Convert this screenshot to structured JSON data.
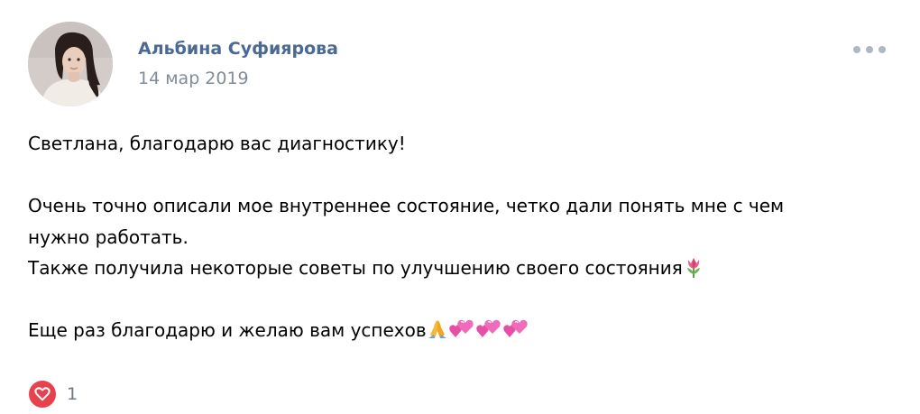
{
  "post": {
    "author": "Альбина Суфиярова",
    "date": "14 мар 2019",
    "text_lines": [
      "Светлана, благодарю вас диагностику!",
      "Очень точно описали мое внутреннее состояние, четко дали понять мне с чем",
      "нужно работать.",
      "Также получила некоторые советы по улучшению своего состояния",
      "Еще раз благодарю и желаю вам успехов"
    ],
    "emojis": {
      "line4": [
        "tulip-emoji"
      ],
      "line5": [
        "folded-hands-emoji",
        "two-hearts-emoji",
        "two-hearts-emoji",
        "two-hearts-emoji"
      ]
    },
    "likes": {
      "count": "1",
      "icon": "heart-icon",
      "color": "#e8414e"
    },
    "more_icon": "more-horizontal-icon",
    "colors": {
      "author": "#4a6a95",
      "date": "#828c99",
      "dots": "#aeb7c2"
    }
  }
}
